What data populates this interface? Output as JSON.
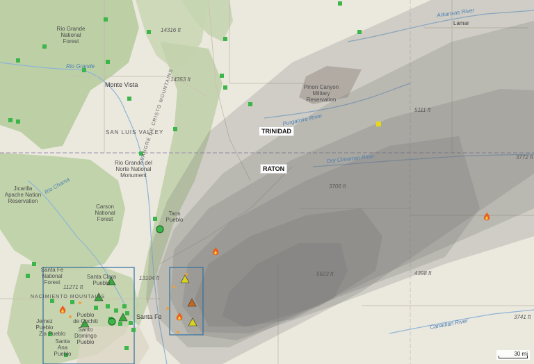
{
  "map": {
    "cities": {
      "trinidad": "TRINIDAD",
      "raton": "RATON"
    },
    "places": {
      "lamar": "Lamar",
      "monte_vista": "Monte Vista",
      "taos_pueblo": "Taos\nPueblo",
      "santa_clara_pueblo": "Santa Clara\nPueblo",
      "pueblo_de_cochiti": "Pueblo\nde Cochiti",
      "santo_domingo_pueblo": "Santo\nDomingo\nPueblo",
      "jemez_pueblo": "Jemez\nPueblo",
      "zia_pueblo": "Zia Pueblo",
      "santa_ana_pueblo": "Santa\nAna\nPueblo",
      "santa_fe": "Santa Fe"
    },
    "regions": {
      "rio_grande_nf": "Rio Grande\nNational\nForest",
      "san_luis_valley": "SAN LUIS VALLEY",
      "rio_grande_del_norte": "Rio Grande del\nNorte National\nMonument",
      "jicarilla": "Jicarilla\nApache Nation\nReservation",
      "carson_nf": "Carson\nNational\nForest",
      "santa_fe_nf": "Santa Fe\nNational\nForest",
      "nacimiento_mtns": "NACIMIENTO MOUNTAINS",
      "pinon_canyon": "Pinon Canyon\nMilitary\nReservation",
      "sangre_de_cristo": "SANGRE DE CRISTO MOUNTAINS"
    },
    "rivers": {
      "arkansas": "Arkansas River",
      "rio_grande": "Rio Grande",
      "rio_chama": "Rio Chama",
      "purgatoire": "Purgatoire River",
      "dry_cimarron": "Dry Cimarron River",
      "canadian": "Canadian River"
    },
    "elevations": {
      "e1": "14316 ft",
      "e2": "14353 ft",
      "e3": "5111 ft",
      "e4": "3772 ft",
      "e5": "3706 ft",
      "e6": "5623 ft",
      "e7": "4398 ft",
      "e8": "3741 ft",
      "e9": "11271 ft",
      "e10": "13104 ft"
    },
    "scale_label": "30 mi",
    "colors": {
      "smoke": "#6f6f6f",
      "station": "#3cb54a",
      "aoi_box": "#2d6fa0",
      "fire": "#e8601c",
      "triangle_yellow": "#d9d21f",
      "triangle_orange": "#c4661d",
      "triangle_green": "#3aa83c",
      "forest": "#b9cfa0"
    },
    "icons": [
      "fire-icon",
      "station-marker",
      "sensor-triangle"
    ]
  }
}
